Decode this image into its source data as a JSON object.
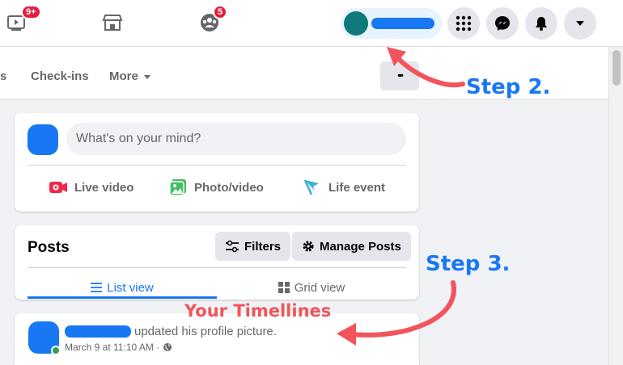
{
  "topbar": {
    "watch_badge": "9+",
    "groups_badge": "5"
  },
  "tabs": {
    "partial": "s",
    "checkins": "Check-ins",
    "more": "More",
    "more_dots": "•••"
  },
  "composer": {
    "placeholder": "What's on your mind?",
    "live_video": "Live video",
    "photo_video": "Photo/video",
    "life_event": "Life event"
  },
  "posts": {
    "title": "Posts",
    "filters": "Filters",
    "manage": "Manage Posts",
    "list_view": "List view",
    "grid_view": "Grid view"
  },
  "post": {
    "action": "updated his profile picture.",
    "meta": "March 9 at 11:10 AM ·"
  },
  "annotations": {
    "step2": "Step 2.",
    "step3": "Step 3.",
    "timelines": "Your Timellines"
  },
  "colors": {
    "accent": "#1877f2",
    "annotation_red": "#f2545b",
    "badge": "#e41e3f"
  }
}
